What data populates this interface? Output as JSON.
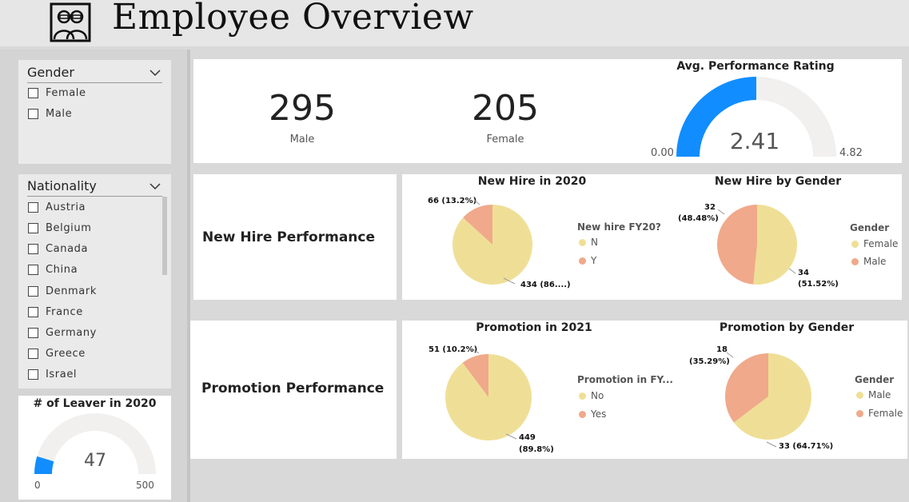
{
  "header": {
    "title": "Employee Overview",
    "logo_icon": "people-icon"
  },
  "slicers": {
    "gender": {
      "title": "Gender",
      "options": [
        "Female",
        "Male"
      ]
    },
    "nationality": {
      "title": "Nationality",
      "options": [
        "Austria",
        "Belgium",
        "Canada",
        "China",
        "Denmark",
        "France",
        "Germany",
        "Greece",
        "Israel"
      ]
    }
  },
  "kpis": {
    "male": {
      "value": "295",
      "label": "Male"
    },
    "female": {
      "value": "205",
      "label": "Female"
    }
  },
  "leaver_gauge": {
    "title": "# of Leaver in 2020",
    "value": 47,
    "value_label": "47",
    "min": 0,
    "min_label": "0",
    "max": 500,
    "max_label": "500"
  },
  "performance_gauge": {
    "title": "Avg. Performance Rating",
    "value": 2.41,
    "value_label": "2.41",
    "min": 0,
    "min_label": "0.00",
    "max": 4.82,
    "max_label": "4.82"
  },
  "sections": {
    "new_hire": "New Hire Performance",
    "promotion": "Promotion Performance"
  },
  "colors": {
    "yellow": "#efdf96",
    "salmon": "#f0a98a",
    "gauge_fill": "#118dff",
    "gauge_track": "#f1f0ef"
  },
  "chart_data": [
    {
      "type": "pie",
      "title": "New Hire in 2020",
      "legend_title": "New hire FY20?",
      "legend_position": "right",
      "categories": [
        "N",
        "Y"
      ],
      "values": [
        434,
        66
      ],
      "data_labels": [
        "434 (86....)",
        "66 (13.2%)"
      ]
    },
    {
      "type": "pie",
      "title": "New Hire by Gender",
      "legend_title": "Gender",
      "legend_position": "right",
      "categories": [
        "Female",
        "Male"
      ],
      "values": [
        34,
        32
      ],
      "data_labels": [
        "34",
        "(51.52%)",
        "32",
        "(48.48%)"
      ]
    },
    {
      "type": "pie",
      "title": "Promotion in 2021",
      "legend_title": "Promotion in FY...",
      "legend_position": "right",
      "categories": [
        "No",
        "Yes"
      ],
      "values": [
        449,
        51
      ],
      "data_labels": [
        "449",
        "(89.8%)",
        "51 (10.2%)"
      ]
    },
    {
      "type": "pie",
      "title": "Promotion by Gender",
      "legend_title": "Gender",
      "legend_position": "right",
      "categories": [
        "Male",
        "Female"
      ],
      "values": [
        33,
        18
      ],
      "data_labels": [
        "33 (64.71%)",
        "18",
        "(35.29%)"
      ]
    }
  ]
}
